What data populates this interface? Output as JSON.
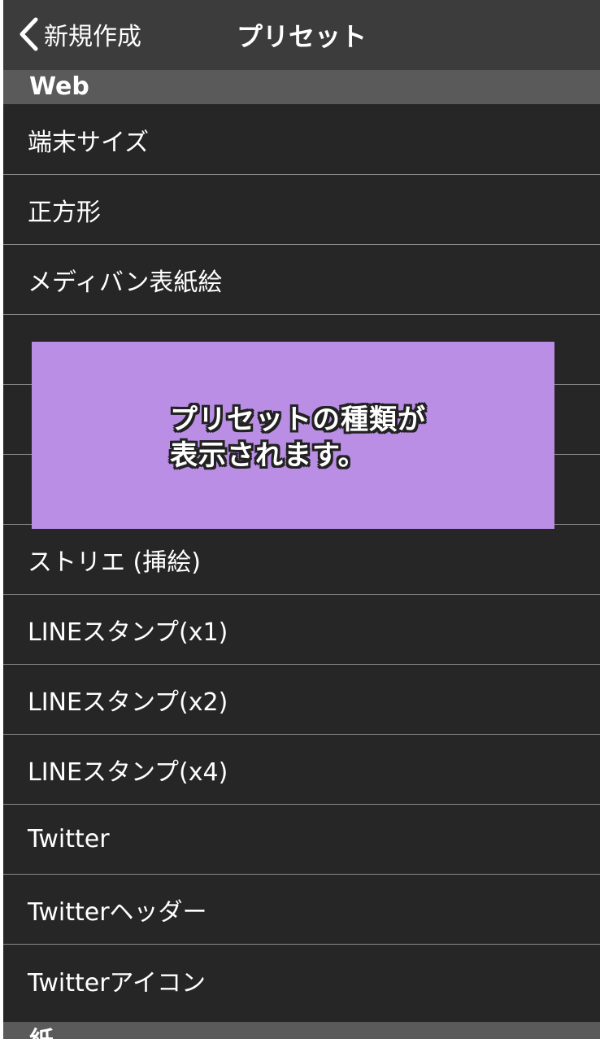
{
  "navbar": {
    "back_label": "新規作成",
    "title": "プリセット"
  },
  "sections": [
    {
      "title": "Web"
    },
    {
      "title": "紙"
    }
  ],
  "web_items": [
    {
      "label": "端末サイズ"
    },
    {
      "label": "正方形"
    },
    {
      "label": "メディバン表紙絵"
    },
    {
      "label": ""
    },
    {
      "label": ""
    },
    {
      "label": ""
    },
    {
      "label": "ストリエ (挿絵)"
    },
    {
      "label": "LINEスタンプ(x1)"
    },
    {
      "label": "LINEスタンプ(x2)"
    },
    {
      "label": "LINEスタンプ(x4)"
    },
    {
      "label": "Twitter"
    },
    {
      "label": "Twitterヘッダー"
    },
    {
      "label": "Twitterアイコン"
    }
  ],
  "overlay": {
    "text": "プリセットの種類が\n表示されます。",
    "color": "#bb8ee6"
  },
  "colors": {
    "background": "#262626",
    "navbar": "#3c3c3c",
    "section_header": "#5a5a5a",
    "separator": "#8a8a8a",
    "text": "#ffffff"
  }
}
